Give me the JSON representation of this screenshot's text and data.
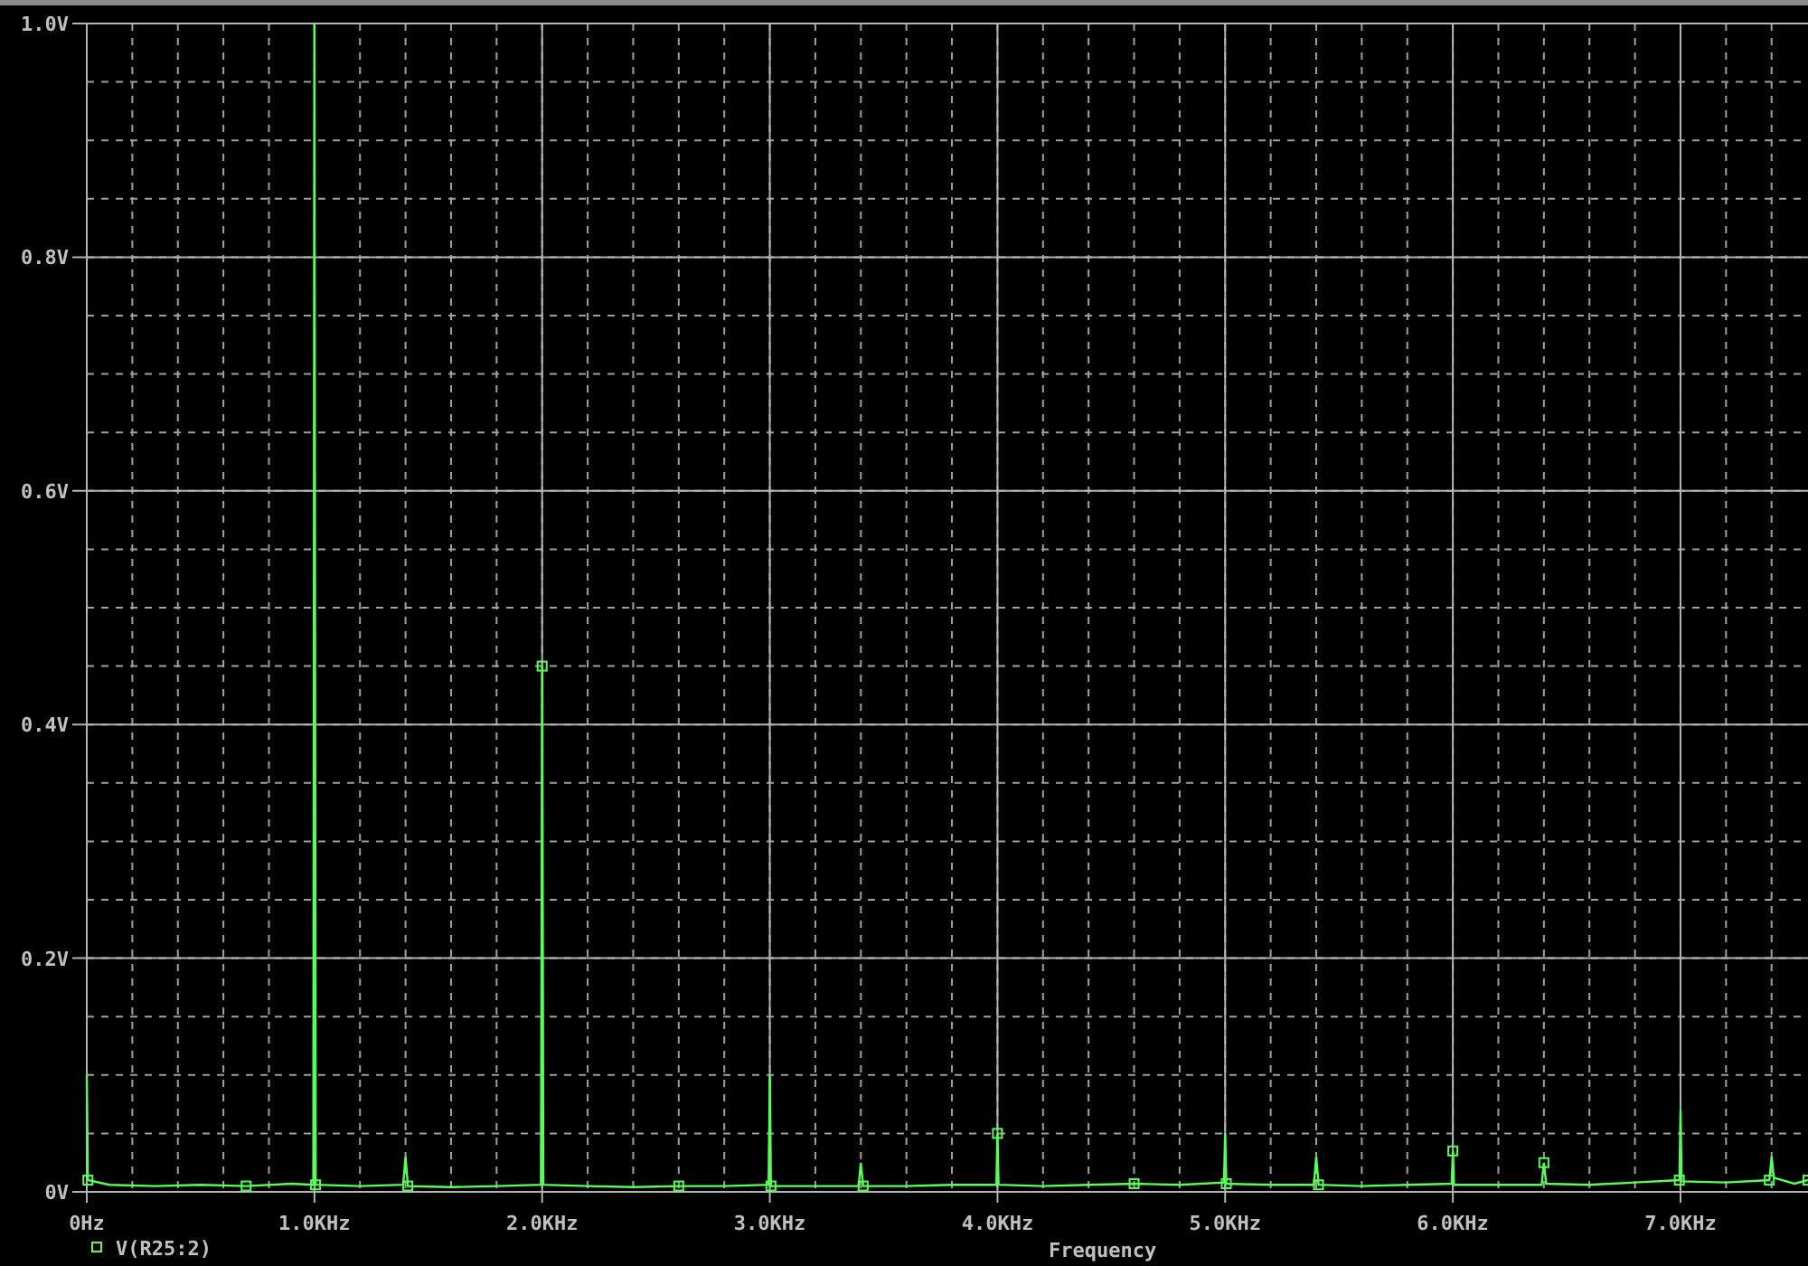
{
  "chart_data": {
    "type": "line",
    "xlabel": "Frequency",
    "grid": true,
    "xlim": [
      0,
      7.56
    ],
    "ylim": [
      0,
      1
    ],
    "xticks": [
      {
        "value": 0,
        "label": "0Hz"
      },
      {
        "value": 1,
        "label": "1.0KHz"
      },
      {
        "value": 2,
        "label": "2.0KHz"
      },
      {
        "value": 3,
        "label": "3.0KHz"
      },
      {
        "value": 4,
        "label": "4.0KHz"
      },
      {
        "value": 5,
        "label": "5.0KHz"
      },
      {
        "value": 6,
        "label": "6.0KHz"
      },
      {
        "value": 7,
        "label": "7.0KHz"
      }
    ],
    "yticks": [
      {
        "value": 0,
        "label": "0V"
      },
      {
        "value": 0.2,
        "label": "0.2V"
      },
      {
        "value": 0.4,
        "label": "0.4V"
      },
      {
        "value": 0.6,
        "label": "0.6V"
      },
      {
        "value": 0.8,
        "label": "0.8V"
      },
      {
        "value": 1,
        "label": "1.0V"
      }
    ],
    "x": [
      0,
      0.005,
      0.1,
      0.3,
      0.5,
      0.7,
      0.9,
      0.995,
      1.0,
      1.005,
      1.2,
      1.39,
      1.4,
      1.41,
      1.6,
      1.8,
      1.995,
      2.0,
      2.005,
      2.2,
      2.4,
      2.6,
      2.8,
      2.995,
      3.0,
      3.005,
      3.2,
      3.39,
      3.4,
      3.41,
      3.6,
      3.8,
      3.995,
      4.0,
      4.005,
      4.2,
      4.4,
      4.6,
      4.8,
      4.995,
      5.0,
      5.005,
      5.2,
      5.39,
      5.4,
      5.41,
      5.6,
      5.8,
      5.995,
      6.0,
      6.005,
      6.2,
      6.39,
      6.4,
      6.41,
      6.6,
      6.8,
      6.995,
      7.0,
      7.005,
      7.2,
      7.39,
      7.4,
      7.41,
      7.5,
      7.56
    ],
    "series": [
      {
        "name": "V(R25:2)",
        "color": "#55ff55",
        "values": [
          0.1,
          0.01,
          0.006,
          0.005,
          0.006,
          0.005,
          0.007,
          0.006,
          1.0,
          0.006,
          0.005,
          0.006,
          0.03,
          0.005,
          0.004,
          0.005,
          0.006,
          0.45,
          0.006,
          0.005,
          0.004,
          0.005,
          0.005,
          0.006,
          0.1,
          0.005,
          0.005,
          0.005,
          0.025,
          0.005,
          0.005,
          0.006,
          0.006,
          0.05,
          0.006,
          0.005,
          0.006,
          0.007,
          0.006,
          0.008,
          0.05,
          0.007,
          0.006,
          0.006,
          0.03,
          0.006,
          0.005,
          0.006,
          0.007,
          0.035,
          0.006,
          0.006,
          0.006,
          0.025,
          0.007,
          0.006,
          0.008,
          0.01,
          0.07,
          0.009,
          0.008,
          0.01,
          0.03,
          0.012,
          0.007,
          0.01
        ]
      }
    ]
  }
}
